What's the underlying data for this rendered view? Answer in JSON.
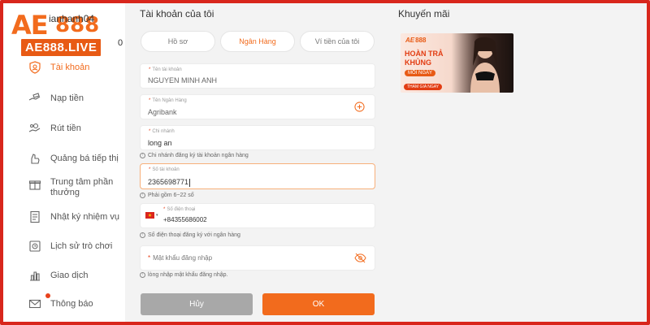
{
  "brand": {
    "logo_ae": "AE",
    "logo_num": "888",
    "logo_live": "AE888.LIVE"
  },
  "user": {
    "name_partial": "ianhanh04",
    "name_tail": "0"
  },
  "sidebar": {
    "items": [
      {
        "label": "Tài khoản",
        "icon": "user-shield-icon",
        "active": true
      },
      {
        "label": "Nạp tiền",
        "icon": "deposit-hand-icon"
      },
      {
        "label": "Rút tiền",
        "icon": "withdraw-coins-icon"
      },
      {
        "label": "Quảng bá tiếp thị",
        "icon": "promo-hand-icon"
      },
      {
        "label": "Trung tâm phần thưởng",
        "icon": "gift-icon"
      },
      {
        "label": "Nhật ký nhiệm vụ",
        "icon": "task-list-icon"
      },
      {
        "label": "Lịch sử trò chơi",
        "icon": "game-history-icon"
      },
      {
        "label": "Giao dịch",
        "icon": "bar-chart-icon"
      },
      {
        "label": "Thông báo",
        "icon": "mail-icon",
        "badge_color": "#e8421c"
      }
    ]
  },
  "main": {
    "title": "Tài khoản của tôi",
    "tabs": [
      {
        "label": "Hồ sơ"
      },
      {
        "label": "Ngân Hàng",
        "active": true
      },
      {
        "label": "Ví tiền của tôi"
      }
    ],
    "form": {
      "account_name": {
        "label": "Tên tài khoản",
        "value": "NGUYEN MINH ANH"
      },
      "bank_name": {
        "label": "Tên Ngân Hàng",
        "value": "Agribank"
      },
      "branch": {
        "label": "Chi nhánh",
        "value": "long an",
        "hint": "Chi nhánh đăng ký tài khoản ngân hàng"
      },
      "account_number": {
        "label": "Số tài khoản",
        "value": "2365698771",
        "hint": "Phải gồm 6~22 số"
      },
      "phone": {
        "label": "Số điện thoại",
        "value": "+84355686002",
        "hint": "Số điện thoại đăng ký với ngân hàng",
        "flag": "vietnam-flag-icon"
      },
      "password": {
        "placeholder": "Mật khẩu đăng nhập",
        "hint": "lòng nhập mật khẩu đăng nhập."
      }
    },
    "buttons": {
      "cancel": "Hủy",
      "ok": "OK"
    }
  },
  "promo": {
    "title": "Khuyến mãi",
    "banner": {
      "logo": "888",
      "line1": "HOÀN TRẢ",
      "line2": "KHỦNG",
      "line3": "MỖI NGÀY",
      "cta": "THAM GIA NGAY"
    }
  },
  "colors": {
    "accent": "#f26b1d",
    "frame": "#d8261c",
    "cancel": "#a8a8a8"
  }
}
